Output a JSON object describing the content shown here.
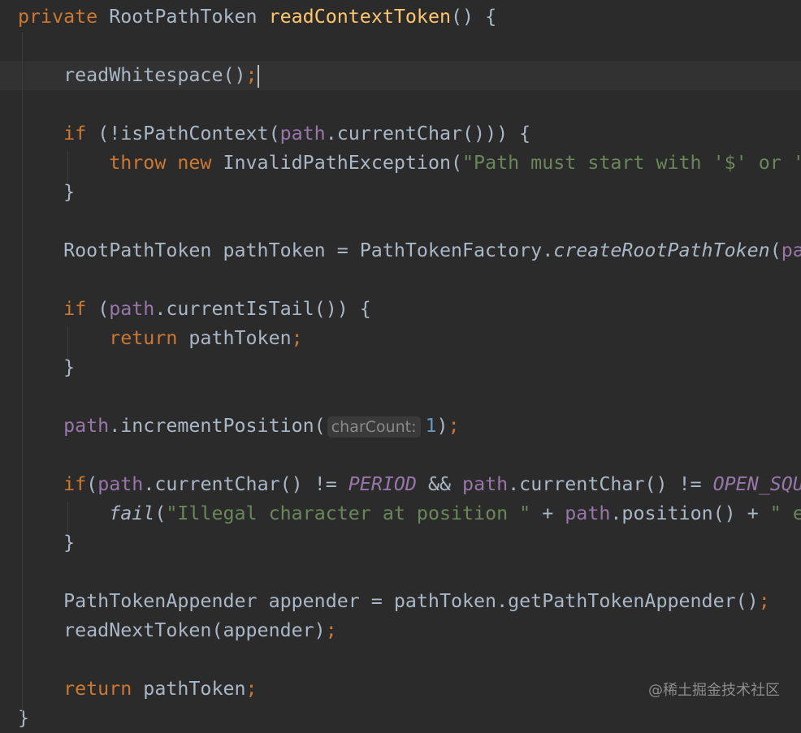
{
  "editor": {
    "current_line": 2,
    "colors": {
      "background": "#2b2b2b",
      "keyword": "#cc7832",
      "text": "#a9b7c6",
      "method_decl": "#ffc66d",
      "string": "#6a8759",
      "field": "#9876aa",
      "number": "#6897bb"
    },
    "lines": [
      [
        [
          "private ",
          "kw"
        ],
        [
          "RootPathToken ",
          ""
        ],
        [
          "readContextToken",
          "decl"
        ],
        [
          "() {",
          ""
        ]
      ],
      [],
      [
        [
          "    readWhitespace()",
          ""
        ],
        [
          ";",
          "kw"
        ],
        [
          "",
          "caret"
        ]
      ],
      [],
      [
        [
          "    ",
          ""
        ],
        [
          "if ",
          "kw"
        ],
        [
          "(!isPathContext(",
          ""
        ],
        [
          "path",
          "field"
        ],
        [
          ".currentChar())) {",
          ""
        ]
      ],
      [
        [
          "        ",
          ""
        ],
        [
          "throw new ",
          "kw"
        ],
        [
          "InvalidPathException(",
          ""
        ],
        [
          "\"Path must start with '$' or '",
          "str"
        ]
      ],
      [
        [
          "    }",
          ""
        ]
      ],
      [],
      [
        [
          "    RootPathToken pathToken = PathTokenFactory.",
          ""
        ],
        [
          "createRootPathToken",
          "ital"
        ],
        [
          "(",
          ""
        ],
        [
          "pa",
          "field"
        ]
      ],
      [],
      [
        [
          "    ",
          ""
        ],
        [
          "if ",
          "kw"
        ],
        [
          "(",
          ""
        ],
        [
          "path",
          "field"
        ],
        [
          ".currentIsTail()) {",
          ""
        ]
      ],
      [
        [
          "        ",
          ""
        ],
        [
          "return ",
          "kw"
        ],
        [
          "pathToken",
          ""
        ],
        [
          ";",
          "kw"
        ]
      ],
      [
        [
          "    }",
          ""
        ]
      ],
      [],
      [
        [
          "    ",
          ""
        ],
        [
          "path",
          "field"
        ],
        [
          ".incrementPosition(",
          ""
        ],
        [
          "charCount:",
          "hint"
        ],
        [
          "1",
          "num"
        ],
        [
          ")",
          ""
        ],
        [
          ";",
          "kw"
        ]
      ],
      [],
      [
        [
          "    ",
          ""
        ],
        [
          "if",
          "kw"
        ],
        [
          "(",
          ""
        ],
        [
          "path",
          "field"
        ],
        [
          ".currentChar() != ",
          ""
        ],
        [
          "PERIOD",
          "const"
        ],
        [
          " && ",
          ""
        ],
        [
          "path",
          "field"
        ],
        [
          ".currentChar() != ",
          ""
        ],
        [
          "OPEN_SQU",
          "const"
        ]
      ],
      [
        [
          "        ",
          ""
        ],
        [
          "fail",
          "ital"
        ],
        [
          "(",
          ""
        ],
        [
          "\"Illegal character at position \"",
          "str"
        ],
        [
          " + ",
          ""
        ],
        [
          "path",
          "field"
        ],
        [
          ".position() + ",
          ""
        ],
        [
          "\" e",
          "str"
        ]
      ],
      [
        [
          "    }",
          ""
        ]
      ],
      [],
      [
        [
          "    PathTokenAppender appender = pathToken.getPathTokenAppender()",
          ""
        ],
        [
          ";",
          "kw"
        ]
      ],
      [
        [
          "    readNextToken(appender)",
          ""
        ],
        [
          ";",
          "kw"
        ]
      ],
      [],
      [
        [
          "    ",
          ""
        ],
        [
          "return ",
          "kw"
        ],
        [
          "pathToken",
          ""
        ],
        [
          ";",
          "kw"
        ]
      ],
      [
        [
          "}",
          ""
        ]
      ]
    ]
  },
  "watermark": "@稀土掘金技术社区"
}
